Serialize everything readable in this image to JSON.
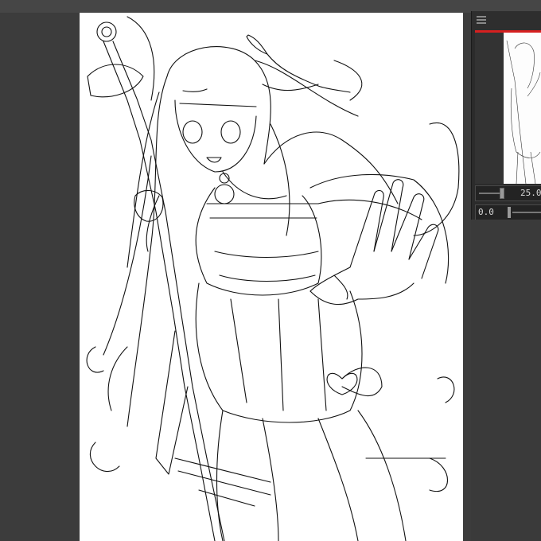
{
  "app": {
    "background": "#3c3c3c",
    "canvas_color": "#ffffff",
    "accent": "#d62020"
  },
  "navigator": {
    "menu_icon": "hamburger-menu-icon",
    "zoom_value": "25.0",
    "rotation_value": "0.0"
  }
}
